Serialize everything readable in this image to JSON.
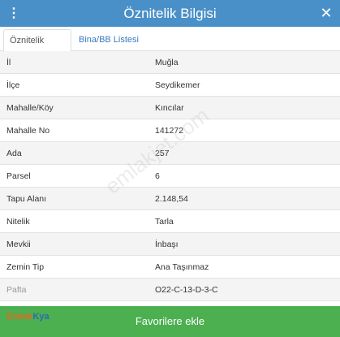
{
  "header": {
    "title": "Öznitelik Bilgisi",
    "menu_icon": "⋮",
    "close_icon": "✕",
    "color": "#4a90c8"
  },
  "tabs": [
    {
      "label": "Öznitelik Bilgisi",
      "active": true
    },
    {
      "label": "Bina/BB Listesi",
      "active": false
    }
  ],
  "attributes": [
    {
      "key": "İl",
      "value": "Muğla"
    },
    {
      "key": "İlçe",
      "value": "Seydikemer"
    },
    {
      "key": "Mahalle/Köy",
      "value": "Kıncılar"
    },
    {
      "key": "Mahalle No",
      "value": "141272"
    },
    {
      "key": "Ada",
      "value": "257"
    },
    {
      "key": "Parsel",
      "value": "6"
    },
    {
      "key": "Tapu Alanı",
      "value": "2.148,54"
    },
    {
      "key": "Nitelik",
      "value": "Tarla"
    },
    {
      "key": "Mevkii",
      "value": "İnbaşı"
    },
    {
      "key": "Zemin Tip",
      "value": "Ana Taşınmaz"
    },
    {
      "key": "Pafta",
      "value": "O22-C-13-D-3-C"
    }
  ],
  "watermark": "emlakjet.com",
  "brand_logo": {
    "part1": "Emlak",
    "part2": "Kya"
  },
  "footer": {
    "favorite_button": "Favorilere ekle",
    "color": "#4caf50"
  }
}
